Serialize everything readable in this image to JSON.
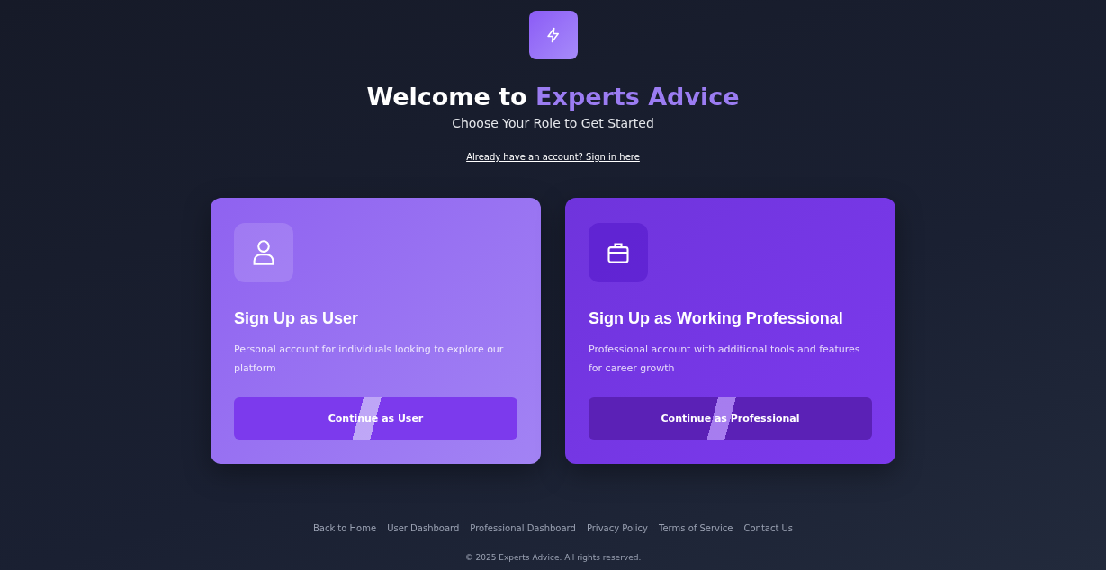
{
  "header": {
    "title": "Welcome to",
    "brand": "Experts Advice",
    "subtitle": "Choose Your Role to Get Started",
    "signin_link": "Already have an account? Sign in here"
  },
  "cards": [
    {
      "kind": "user",
      "title": "Sign Up as User",
      "description": "Personal account for individuals looking to explore our platform",
      "button": "Continue as User"
    },
    {
      "kind": "professional",
      "title": "Sign Up as Working Professional",
      "description": "Professional account with additional tools and features for career growth",
      "button": "Continue as Professional"
    }
  ],
  "footer": {
    "links": [
      "Back to Home",
      "User Dashboard",
      "Professional Dashboard",
      "Privacy Policy",
      "Terms of Service",
      "Contact Us"
    ],
    "copyright": "© 2025 Experts Advice. All rights reserved."
  }
}
